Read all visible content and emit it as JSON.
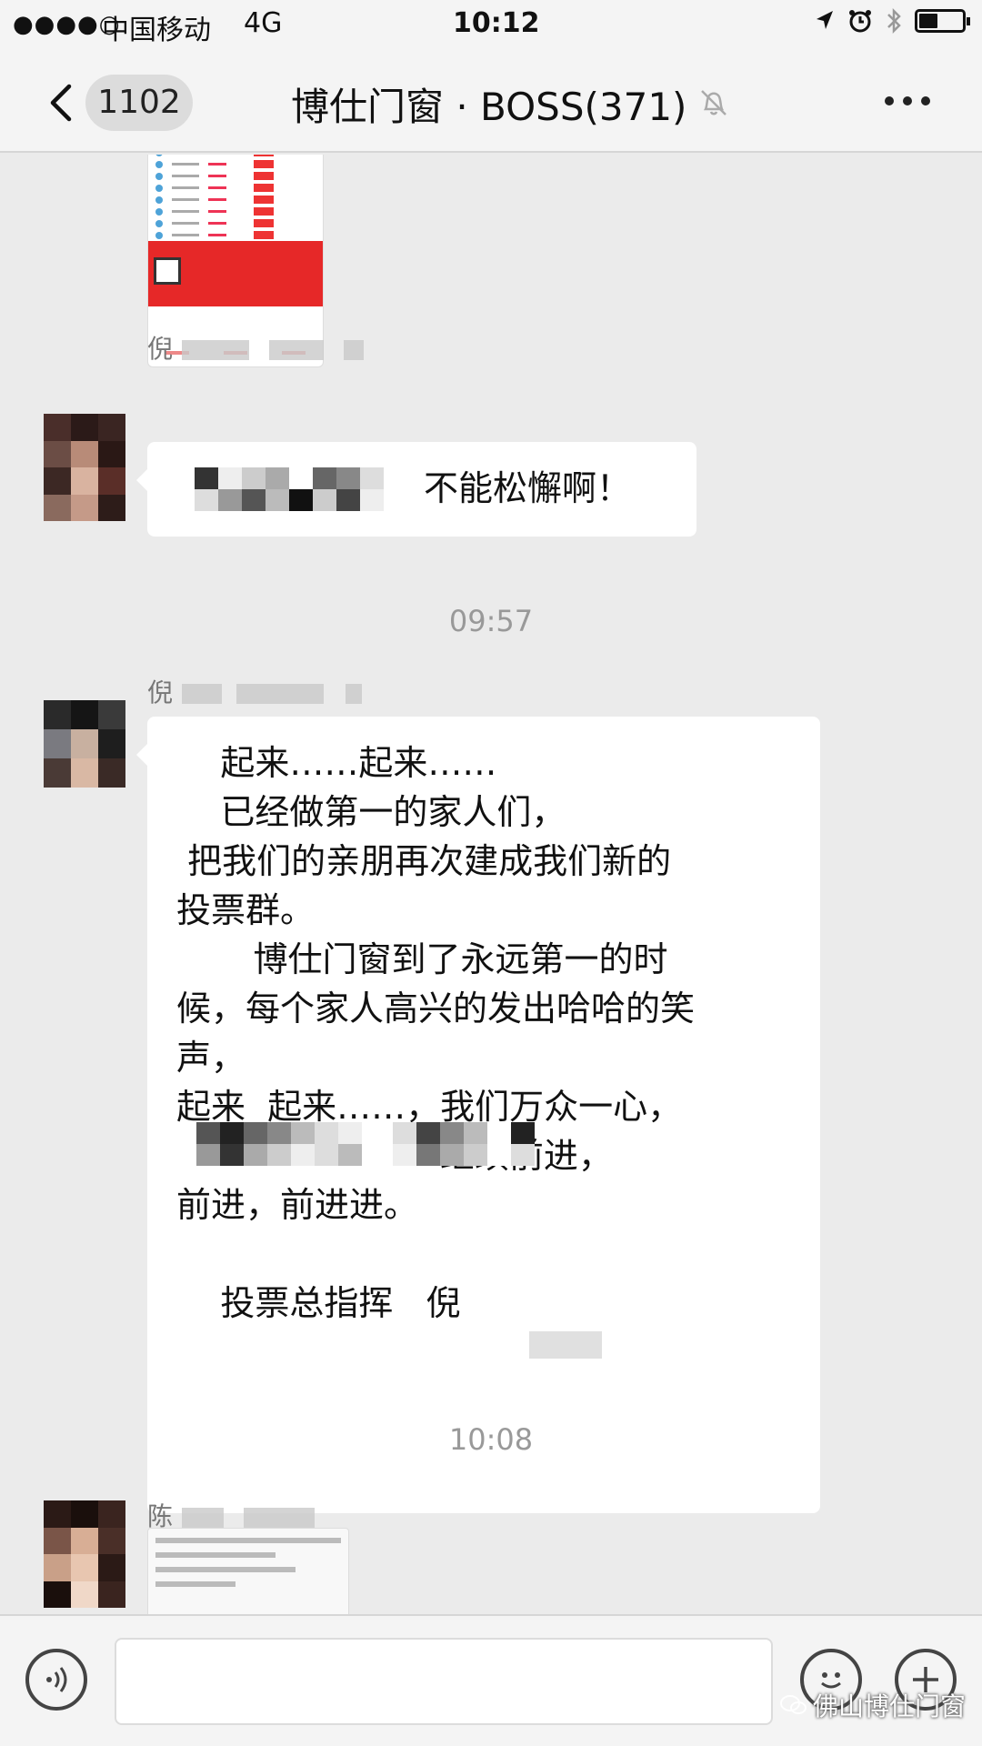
{
  "status_bar": {
    "signal": "●●●●○",
    "carrier": "中国移动",
    "network": "4G",
    "time": "10:12"
  },
  "nav": {
    "unread_count": "1102",
    "title": "博仕门窗 · BOSS(371)"
  },
  "messages": [
    {
      "sender": "倪",
      "text": "不能松懈啊！"
    },
    {
      "timestamp": "09:57",
      "sender": "倪",
      "lines": [
        "    起来……起来……",
        "    已经做第一的家人们，",
        " 把我们的亲朋再次建成我们新的",
        "投票群。",
        "       博仕门窗到了永远第一的时",
        "候，每个家人高兴的发出哈哈的笑",
        "声，",
        "起来  起来……，我们万众一心，",
        "                        继续前进，",
        "前进，前进进。",
        "",
        "    投票总指挥   倪"
      ]
    },
    {
      "timestamp": "10:08",
      "sender": "陈"
    }
  ],
  "input": {
    "placeholder": ""
  },
  "watermark": {
    "text": "佛山博仕门窗"
  },
  "colors": {
    "background": "#ebebeb",
    "bar": "#f4f4f4",
    "bubble": "#ffffff",
    "timestamp": "#999999"
  }
}
